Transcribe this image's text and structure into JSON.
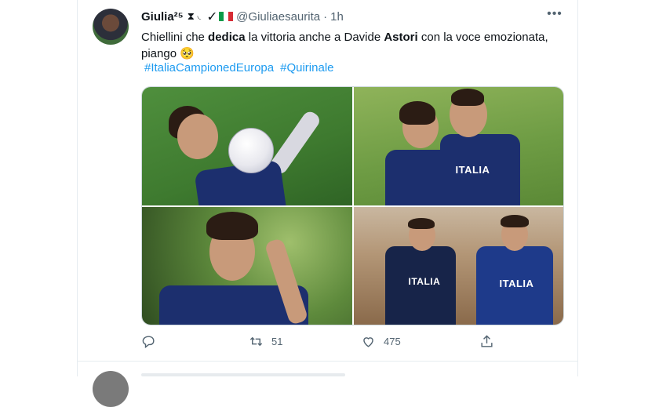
{
  "tweet": {
    "display_name": "Giulia²⁵",
    "name_emoji": "⧗ ◟ ✓",
    "handle": "@Giuliaesaurita",
    "separator": "·",
    "time": "1h",
    "text_parts": [
      "Chiellini che ",
      "dedica",
      " la vittoria anche a Davide ",
      "Astori",
      " con la voce emozionata, piango 🥺"
    ],
    "hashtags": [
      "#ItaliaCampionedEuropa",
      "#Quirinale"
    ],
    "media_labels": [
      "ITALIA",
      "ITALIA",
      "ITALIA"
    ],
    "actions": {
      "reply_count": "",
      "retweet_count": "51",
      "like_count": "475"
    },
    "colors": {
      "link": "#1d9bf0",
      "secondary": "#536471"
    }
  }
}
